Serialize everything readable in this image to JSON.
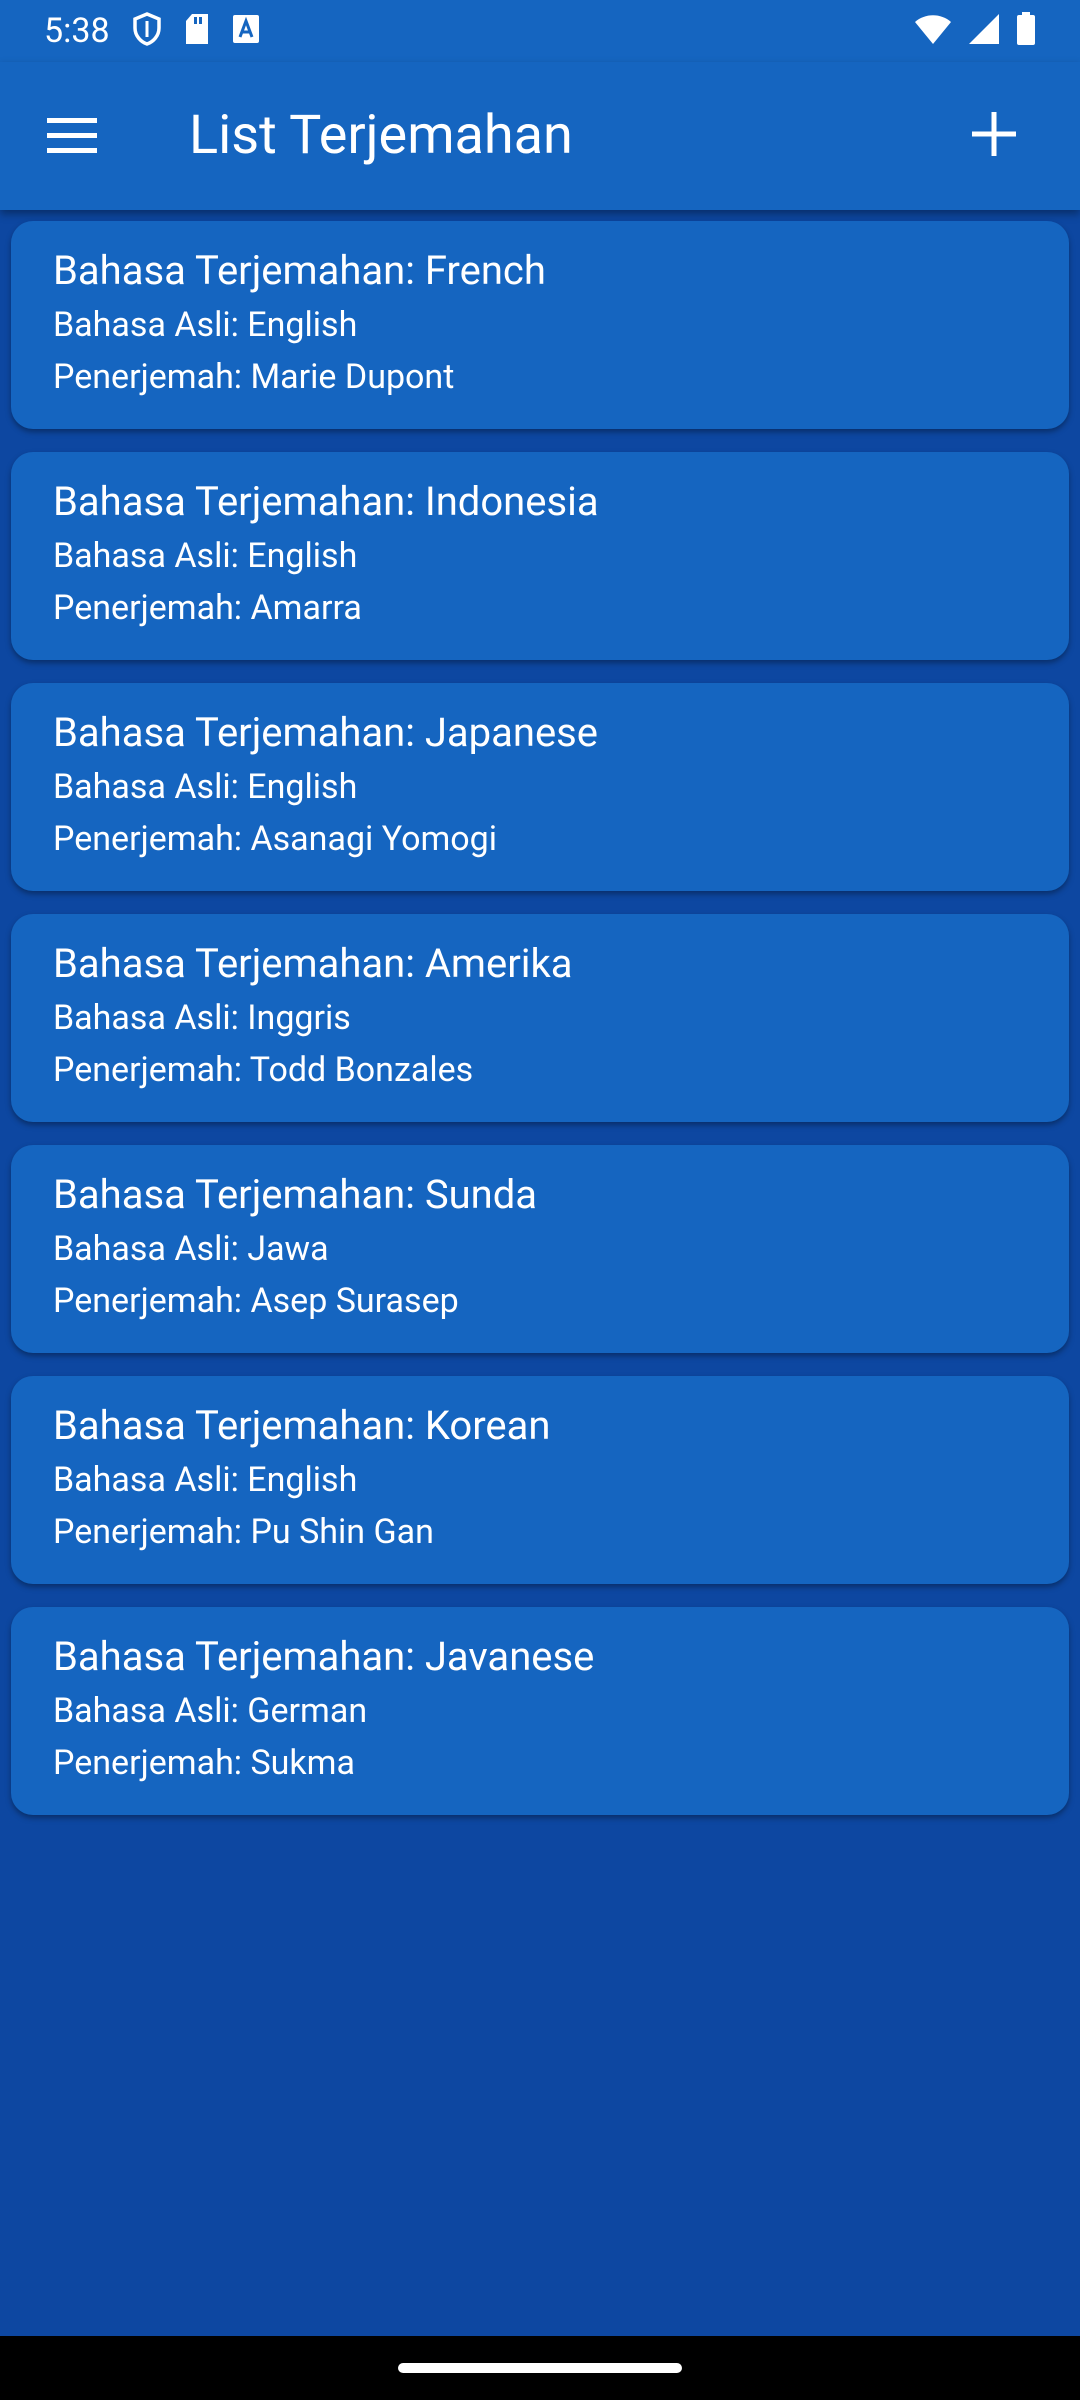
{
  "status_bar": {
    "time": "5:38"
  },
  "app_bar": {
    "title": "List Terjemahan"
  },
  "translations": [
    {
      "title": "Bahasa Terjemahan: French",
      "source": "Bahasa Asli: English",
      "translator": "Penerjemah: Marie Dupont"
    },
    {
      "title": "Bahasa Terjemahan: Indonesia",
      "source": "Bahasa Asli: English",
      "translator": "Penerjemah: Amarra"
    },
    {
      "title": "Bahasa Terjemahan: Japanese",
      "source": "Bahasa Asli: English",
      "translator": "Penerjemah: Asanagi Yomogi"
    },
    {
      "title": "Bahasa Terjemahan: Amerika",
      "source": "Bahasa Asli: Inggris",
      "translator": "Penerjemah: Todd Bonzales"
    },
    {
      "title": "Bahasa Terjemahan: Sunda",
      "source": "Bahasa Asli: Jawa",
      "translator": "Penerjemah: Asep Surasep"
    },
    {
      "title": "Bahasa Terjemahan: Korean",
      "source": "Bahasa Asli: English",
      "translator": "Penerjemah: Pu Shin Gan"
    },
    {
      "title": "Bahasa Terjemahan: Javanese",
      "source": "Bahasa Asli: German",
      "translator": "Penerjemah: Sukma"
    }
  ],
  "icons": {
    "menu": "menu-icon",
    "add": "add-icon",
    "status": [
      "shield-icon",
      "sd-card-icon",
      "font-icon",
      "wifi-icon",
      "signal-icon",
      "battery-icon"
    ]
  },
  "colors": {
    "app_bar": "#1565C0",
    "background": "#0D47A1",
    "card": "#1565C0",
    "text": "#FFFFFF"
  }
}
